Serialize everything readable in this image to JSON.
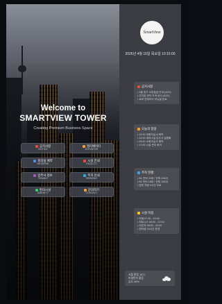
{
  "welcome": {
    "line1": "Welcome to",
    "line2": "SMARTVIEW TOWER",
    "subtitle": "Creating Premium Business Space"
  },
  "menu": [
    {
      "label": "공지사항",
      "sub": "NOTICE",
      "color": "#e84b3c",
      "icon": "megaphone-icon"
    },
    {
      "label": "엘리베이터",
      "sub": "ELEVATOR",
      "color": "#f0a030",
      "icon": "elevator-icon"
    },
    {
      "label": "회의실 예약",
      "sub": "RESERVE",
      "color": "#4a90e2",
      "icon": "calendar-icon"
    },
    {
      "label": "시설 안내",
      "sub": "FACILITY",
      "color": "#e84b3c",
      "icon": "building-icon"
    },
    {
      "label": "입주사 정보",
      "sub": "TENANT",
      "color": "#9b59b6",
      "icon": "office-icon"
    },
    {
      "label": "주차 안내",
      "sub": "PARKING",
      "color": "#3aa4d8",
      "icon": "parking-icon"
    },
    {
      "label": "편의시설",
      "sub": "AMENITY",
      "color": "#2ecc71",
      "icon": "coffee-icon"
    },
    {
      "label": "문의하기",
      "sub": "CONTACT",
      "color": "#f0a030",
      "icon": "phone-icon"
    }
  ],
  "sidebar": {
    "logo_text": "SmartView",
    "datetime": "2026년 4월 15일 목요일 10:15:00",
    "cards": [
      {
        "title": "공지사항",
        "color": "#e84b3c",
        "icon": "megaphone-icon",
        "lines": [
          "• 4월 정기 소방점검 안내 (4/20)",
          "• 주차장 바닥 도색 공사 (4/22)",
          "• 로비 인테리어 리뉴얼 완료"
        ]
      },
      {
        "title": "오늘의 일정",
        "color": "#f0a030",
        "icon": "calendar-icon",
        "lines": [
          "• 10:00 대회의실 A 예약",
          "• 13:30 세미나실 입주사 설명회",
          "• 15:00 소회의실 B 예약",
          "• 17:00 시설 관리 회의"
        ]
      },
      {
        "title": "주차 현황",
        "color": "#3aa4d8",
        "icon": "parking-icon",
        "lines": [
          "• B1 잔여 32대 / 전체 120대",
          "• B2 잔여 18대 / 전체 150대",
          "• 방문 차량 2시간 무료"
        ]
      },
      {
        "title": "시설 이용",
        "color": "#f0c419",
        "icon": "coffee-icon",
        "lines": [
          "• 카페 07:30 - 19:00",
          "• 피트니스 06:00 - 22:00",
          "• 라운지 08:00 - 20:00",
          "• 편의점 24시간 운영"
        ]
      }
    ],
    "weather": {
      "line1": "서울 맑음 18°C",
      "line2": "미세먼지 좋음",
      "line3": "습도 45%",
      "icon": "cloud-icon"
    }
  }
}
